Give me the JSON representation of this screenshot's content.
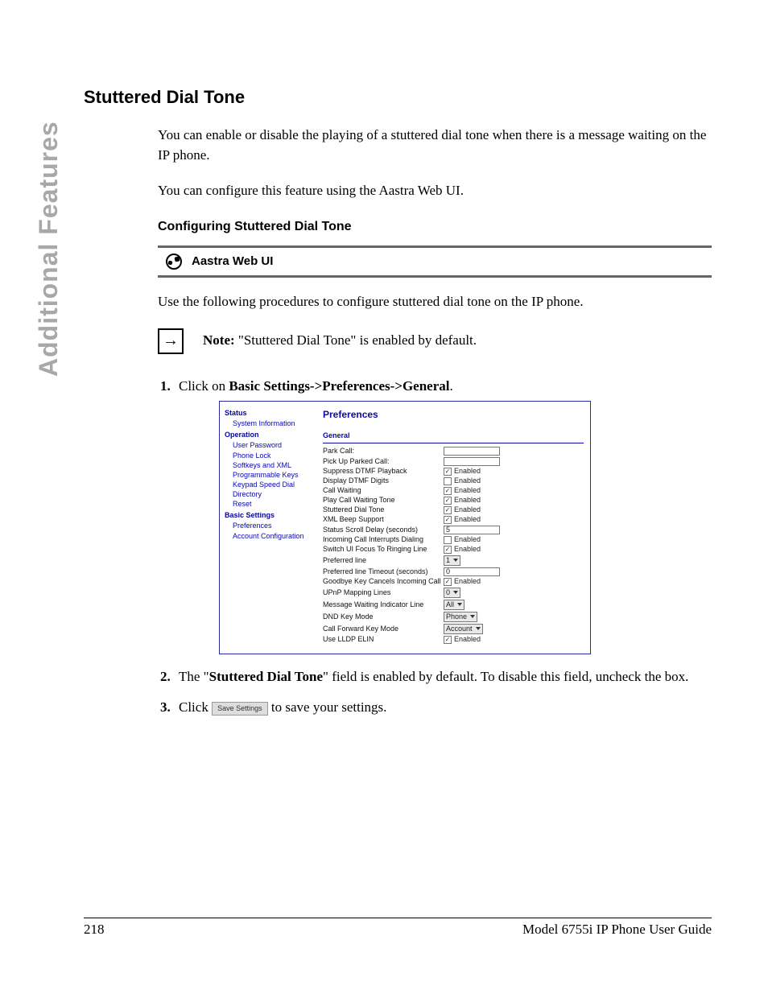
{
  "side_label": "Additional Features",
  "section_title": "Stuttered Dial Tone",
  "para1": "You can enable or disable the playing of a stuttered dial tone when there is a message waiting on the IP phone.",
  "para2": "You can configure this feature using the Aastra Web UI.",
  "subheading": "Configuring Stuttered Dial Tone",
  "webui_label": "Aastra Web UI",
  "para3": "Use the following procedures to configure stuttered dial tone on the IP phone.",
  "note_label": "Note:",
  "note_text": " \"Stuttered Dial Tone\" is enabled by default.",
  "step1_prefix": "Click on ",
  "step1_bold": "Basic Settings->Preferences->General",
  "step1_suffix": ".",
  "step2_prefix": "The \"",
  "step2_bold": "Stuttered Dial Tone",
  "step2_suffix": "\" field is enabled by default. To disable this field, uncheck the box.",
  "step3_prefix": "Click ",
  "step3_btn": "Save Settings",
  "step3_suffix": " to save your settings.",
  "footer": {
    "page": "218",
    "title": "Model 6755i IP Phone User Guide"
  },
  "embed": {
    "nav": {
      "status": "Status",
      "status_items": [
        "System Information"
      ],
      "operation": "Operation",
      "operation_items": [
        "User Password",
        "Phone Lock",
        "Softkeys and XML",
        "Programmable Keys",
        "Keypad Speed Dial",
        "Directory",
        "Reset"
      ],
      "basic": "Basic Settings",
      "basic_items": [
        "Preferences",
        "Account Configuration"
      ]
    },
    "title": "Preferences",
    "group": "General",
    "rows": [
      {
        "label": "Park Call:",
        "type": "text",
        "value": ""
      },
      {
        "label": "Pick Up Parked Call:",
        "type": "text",
        "value": ""
      },
      {
        "label": "Suppress DTMF Playback",
        "type": "check",
        "checked": true,
        "text": "Enabled"
      },
      {
        "label": "Display DTMF Digits",
        "type": "check",
        "checked": false,
        "text": "Enabled"
      },
      {
        "label": "Call Waiting",
        "type": "check",
        "checked": true,
        "text": "Enabled"
      },
      {
        "label": "Play Call Waiting Tone",
        "type": "check",
        "checked": true,
        "text": "Enabled"
      },
      {
        "label": "Stuttered Dial Tone",
        "type": "check",
        "checked": true,
        "text": "Enabled"
      },
      {
        "label": "XML Beep Support",
        "type": "check",
        "checked": true,
        "text": "Enabled"
      },
      {
        "label": "Status Scroll Delay (seconds)",
        "type": "text",
        "value": "5"
      },
      {
        "label": "Incoming Call Interrupts Dialing",
        "type": "check",
        "checked": false,
        "text": "Enabled"
      },
      {
        "label": "Switch UI Focus To Ringing Line",
        "type": "check",
        "checked": true,
        "text": "Enabled"
      },
      {
        "label": "Preferred line",
        "type": "select",
        "value": "1"
      },
      {
        "label": "Preferred line Timeout (seconds)",
        "type": "text",
        "value": "0"
      },
      {
        "label": "Goodbye Key Cancels Incoming Call",
        "type": "check",
        "checked": true,
        "text": "Enabled"
      },
      {
        "label": "UPnP Mapping Lines",
        "type": "select",
        "value": "0"
      },
      {
        "label": "Message Waiting Indicator Line",
        "type": "select",
        "value": "All"
      },
      {
        "label": "DND Key Mode",
        "type": "select",
        "value": "Phone"
      },
      {
        "label": "Call Forward Key Mode",
        "type": "select",
        "value": "Account"
      },
      {
        "label": "Use LLDP ELIN",
        "type": "check",
        "checked": true,
        "text": "Enabled"
      }
    ]
  }
}
